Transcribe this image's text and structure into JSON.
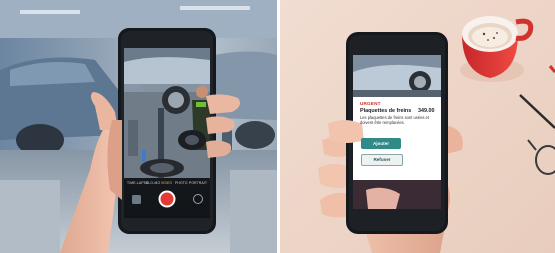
{
  "left_photo": {
    "camera_modes": [
      "TIME-LAPSE",
      "SLO-MO",
      "VIDEO",
      "PHOTO",
      "PORTRAIT"
    ],
    "active_mode_index": 2,
    "capture_button_color": "#e53935"
  },
  "right_photo": {
    "card": {
      "status_label": "URGENT",
      "item_title": "Plaquettes de freins",
      "item_price": "349.00",
      "item_description": "Les plaquettes de freins sont usées et doivent être remplacées.",
      "accept_label": "Ajouter",
      "refuse_label": "Refuser"
    },
    "accent_color": "#2f8a88",
    "status_color": "#c2332b",
    "cup_color": "#e53935"
  }
}
